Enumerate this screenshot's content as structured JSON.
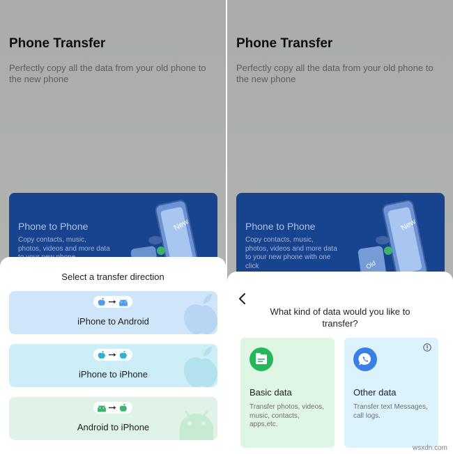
{
  "left_screen": {
    "app_title": "Phone Transfer",
    "app_subtitle": "Perfectly copy all the data from your old phone to the new phone",
    "promo": {
      "title": "Phone to Phone",
      "description": "Copy contacts, music, photos, videos and more data to your new phone"
    },
    "sheet": {
      "title": "Select a transfer direction",
      "options": [
        {
          "label": "iPhone to Android",
          "from_icon": "apple-icon",
          "to_icon": "android-icon"
        },
        {
          "label": "iPhone to iPhone",
          "from_icon": "apple-icon",
          "to_icon": "apple-icon"
        },
        {
          "label": "Android to iPhone",
          "from_icon": "android-icon",
          "to_icon": "apple-icon"
        }
      ]
    }
  },
  "right_screen": {
    "app_title": "Phone Transfer",
    "app_subtitle": "Perfectly copy all the data from your old phone to the new phone",
    "promo": {
      "title": "Phone to Phone",
      "description": "Copy contacts, music, photos, videos and more data to your new phone with one click"
    },
    "sheet": {
      "question": "What kind of data would you like to transfer?",
      "options": [
        {
          "title": "Basic data",
          "description": "Transfer photos, videos, music, contacts, apps,etc.",
          "icon": "file-icon"
        },
        {
          "title": "Other data",
          "description": "Transfer text Messages, call logs.",
          "icon": "chat-phone-icon"
        }
      ]
    }
  },
  "promo_art": {
    "new_label": "New",
    "old_label": "Old"
  },
  "watermark": "wsxdn.com",
  "colors": {
    "promo_blue": "#17438f",
    "apple_icon_blue": "#4b9ded",
    "android_icon_green": "#3bb36a",
    "file_icon_green": "#26b75a",
    "chat_icon_blue": "#3a7fe6"
  }
}
